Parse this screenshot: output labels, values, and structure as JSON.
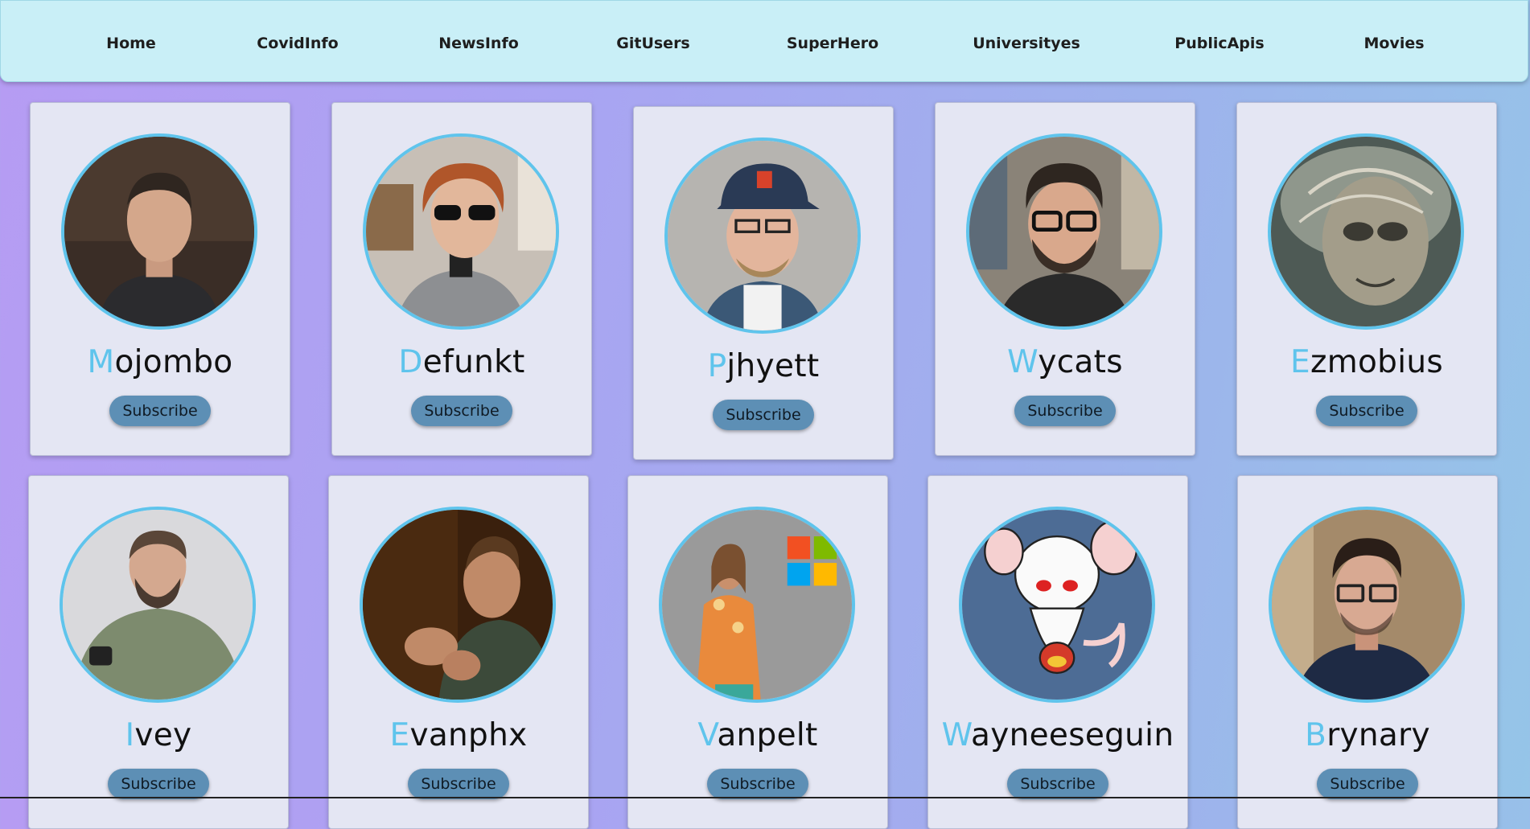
{
  "nav": {
    "items": [
      "Home",
      "CovidInfo",
      "NewsInfo",
      "GitUsers",
      "SuperHero",
      "Universityes",
      "PublicApis",
      "Movies"
    ]
  },
  "users": [
    {
      "first": "M",
      "rest": "ojombo",
      "button": "Subscribe"
    },
    {
      "first": "D",
      "rest": "efunkt",
      "button": "Subscribe"
    },
    {
      "first": "P",
      "rest": "jhyett",
      "button": "Subscribe"
    },
    {
      "first": "W",
      "rest": "ycats",
      "button": "Subscribe"
    },
    {
      "first": "E",
      "rest": "zmobius",
      "button": "Subscribe"
    },
    {
      "first": "I",
      "rest": "vey",
      "button": "Subscribe"
    },
    {
      "first": "E",
      "rest": "vanphx",
      "button": "Subscribe"
    },
    {
      "first": "V",
      "rest": "anpelt",
      "button": "Subscribe"
    },
    {
      "first": "W",
      "rest": "ayneeseguin",
      "button": "Subscribe"
    },
    {
      "first": "B",
      "rest": "rynary",
      "button": "Subscribe"
    }
  ],
  "colors": {
    "accent": "#5fc4ec",
    "button": "#5d8fb5",
    "navbar": "#c9eff7",
    "card": "#e4e6f3"
  }
}
